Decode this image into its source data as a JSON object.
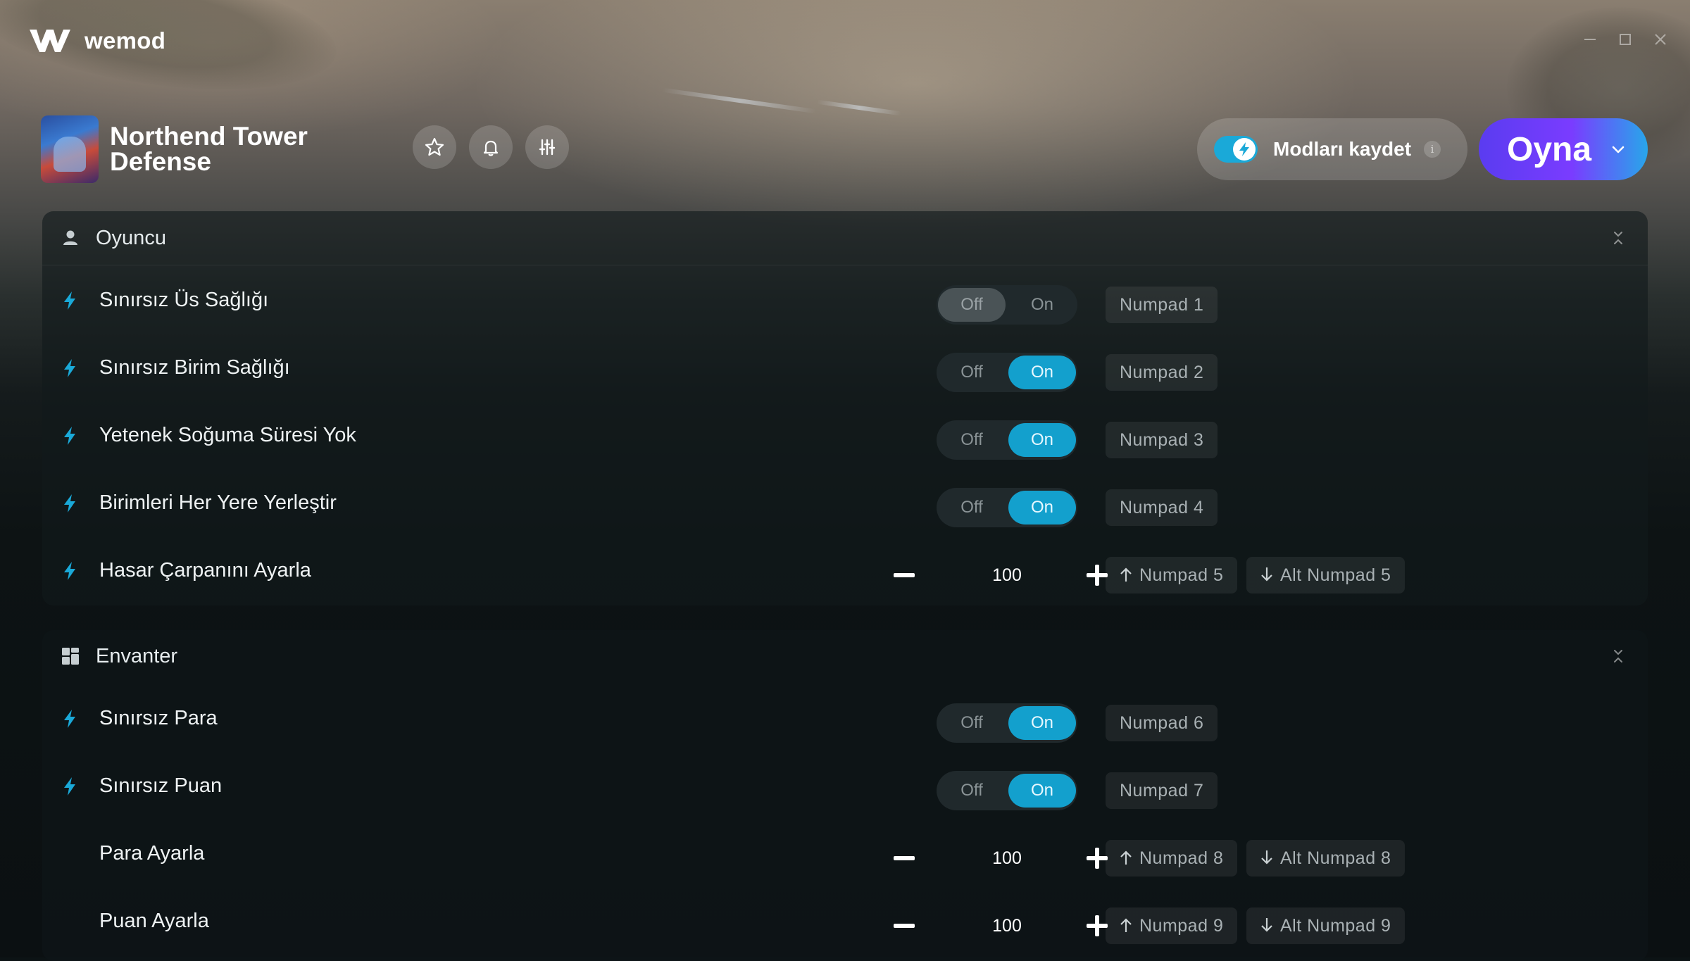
{
  "app": {
    "name": "wemod"
  },
  "window_controls": [
    "minimize",
    "maximize",
    "close"
  ],
  "game": {
    "title": "Northend Tower Defense"
  },
  "header_buttons": [
    "favorite",
    "notifications",
    "settings"
  ],
  "save_mods": {
    "label": "Modları kaydet",
    "enabled": true,
    "info": "i"
  },
  "play": {
    "label": "Oyna"
  },
  "colors": {
    "accent": "#13a0cd",
    "play_start": "#5a3cf0",
    "play_end": "#28a6ea"
  },
  "sections": [
    {
      "label": "Oyuncu",
      "icon": "user-icon"
    },
    {
      "label": "Envanter",
      "icon": "grid-icon"
    }
  ],
  "mods": [
    {
      "label": "Sınırsız Üs Sağlığı",
      "type": "toggle",
      "state": "Off",
      "off": "Off",
      "on": "On",
      "hotkey": "Numpad 1"
    },
    {
      "label": "Sınırsız Birim Sağlığı",
      "type": "toggle",
      "state": "On",
      "off": "Off",
      "on": "On",
      "hotkey": "Numpad 2"
    },
    {
      "label": "Yetenek Soğuma Süresi Yok",
      "type": "toggle",
      "state": "On",
      "off": "Off",
      "on": "On",
      "hotkey": "Numpad 3"
    },
    {
      "label": "Birimleri Her Yere Yerleştir",
      "type": "toggle",
      "state": "On",
      "off": "Off",
      "on": "On",
      "hotkey": "Numpad 4"
    },
    {
      "label": "Hasar Çarpanını Ayarla",
      "type": "number",
      "value": "100",
      "hotkey_up": "Numpad 5",
      "hotkey_down": "Alt Numpad 5"
    },
    {
      "label": "Sınırsız Para",
      "type": "toggle",
      "state": "On",
      "off": "Off",
      "on": "On",
      "hotkey": "Numpad 6"
    },
    {
      "label": "Sınırsız Puan",
      "type": "toggle",
      "state": "On",
      "off": "Off",
      "on": "On",
      "hotkey": "Numpad 7"
    },
    {
      "label": "Para Ayarla",
      "type": "number",
      "value": "100",
      "hotkey_up": "Numpad 8",
      "hotkey_down": "Alt Numpad 8"
    },
    {
      "label": "Puan Ayarla",
      "type": "number",
      "value": "100",
      "hotkey_up": "Numpad 9",
      "hotkey_down": "Alt Numpad 9"
    }
  ]
}
